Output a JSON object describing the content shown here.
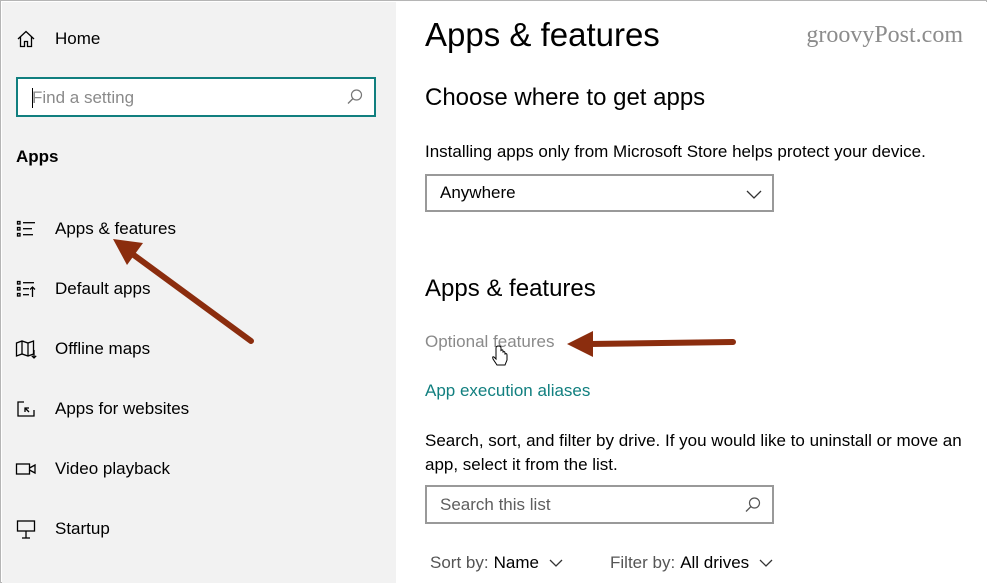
{
  "sidebar": {
    "home_label": "Home",
    "search_placeholder": "Find a setting",
    "section_title": "Apps",
    "items": [
      {
        "label": "Apps & features",
        "icon": "list-icon"
      },
      {
        "label": "Default apps",
        "icon": "default-apps-icon"
      },
      {
        "label": "Offline maps",
        "icon": "map-icon"
      },
      {
        "label": "Apps for websites",
        "icon": "external-link-icon"
      },
      {
        "label": "Video playback",
        "icon": "video-icon"
      },
      {
        "label": "Startup",
        "icon": "startup-icon"
      }
    ]
  },
  "main": {
    "title": "Apps & features",
    "watermark": "groovyPost.com",
    "choose_heading": "Choose where to get apps",
    "choose_description": "Installing apps only from Microsoft Store helps protect your device.",
    "source_dropdown_value": "Anywhere",
    "features_heading": "Apps & features",
    "optional_features_link": "Optional features",
    "aliases_link": "App execution aliases",
    "list_description": "Search, sort, and filter by drive. If you would like to uninstall or move an app, select it from the list.",
    "list_search_placeholder": "Search this list",
    "sort_key": "Sort by:",
    "sort_value": "Name",
    "filter_key": "Filter by:",
    "filter_value": "All drives"
  },
  "colors": {
    "accent": "#117f7f",
    "annotation_arrow": "#8b2d0e",
    "sidebar_bg": "#f2f2f2"
  }
}
